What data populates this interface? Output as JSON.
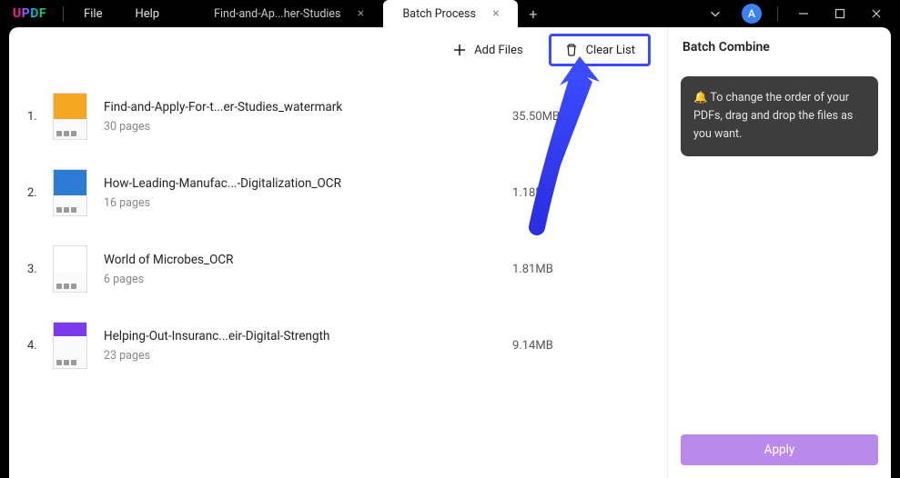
{
  "app": {
    "logo": "UPDF"
  },
  "menu": {
    "file": "File",
    "help": "Help"
  },
  "tabs": [
    {
      "label": "Find-and-Ap...her-Studies",
      "active": false
    },
    {
      "label": "Batch Process",
      "active": true
    }
  ],
  "avatar": "A",
  "toolbar": {
    "add_files": "Add Files",
    "clear_list": "Clear List"
  },
  "files": [
    {
      "idx": "1.",
      "name": "Find-and-Apply-For-t...er-Studies_watermark",
      "pages": "30 pages",
      "size": "35.50MB",
      "thumb": "orange"
    },
    {
      "idx": "2.",
      "name": "How-Leading-Manufac...-Digitalization_OCR",
      "pages": "16 pages",
      "size": "1.18MB",
      "thumb": "blue"
    },
    {
      "idx": "3.",
      "name": "World of Microbes_OCR",
      "pages": "6 pages",
      "size": "1.81MB",
      "thumb": "white"
    },
    {
      "idx": "4.",
      "name": "Helping-Out-Insuranc...eir-Digital-Strength",
      "pages": "23 pages",
      "size": "9.14MB",
      "thumb": "purple"
    }
  ],
  "sidebar": {
    "title": "Batch Combine",
    "tip": "🔔 To change the order of your PDFs, drag and drop the files as you want.",
    "apply": "Apply"
  }
}
